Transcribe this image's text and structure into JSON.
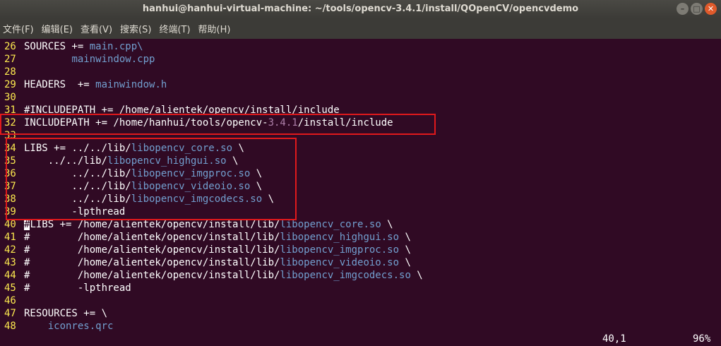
{
  "window": {
    "title": "hanhui@hanhui-virtual-machine: ~/tools/opencv-3.4.1/install/QOpenCV/opencvdemo",
    "buttons": [
      "minimize",
      "maximize",
      "close"
    ]
  },
  "menu": [
    "文件(F)",
    "编辑(E)",
    "查看(V)",
    "搜索(S)",
    "终端(T)",
    "帮助(H)"
  ],
  "lines": [
    {
      "n": "26",
      "segs": [
        [
          "SOURCES += ",
          ""
        ],
        [
          "main.cpp\\",
          "fnblue"
        ]
      ]
    },
    {
      "n": "27",
      "segs": [
        [
          "        ",
          ""
        ],
        [
          "mainwindow.cpp",
          "fnblue"
        ]
      ]
    },
    {
      "n": "28",
      "segs": []
    },
    {
      "n": "29",
      "segs": [
        [
          "HEADERS  += ",
          ""
        ],
        [
          "mainwindow.h",
          "fnblue"
        ]
      ]
    },
    {
      "n": "30",
      "segs": []
    },
    {
      "n": "31",
      "segs": [
        [
          "#INCLUDEPATH += /home/alientek/opencv/install/include",
          ""
        ]
      ]
    },
    {
      "n": "32",
      "segs": [
        [
          "INCLUDEPATH += /home/hanhui/tools/opencv-",
          ""
        ],
        [
          "3.4.1",
          "num"
        ],
        [
          "/install/include",
          ""
        ]
      ]
    },
    {
      "n": "33",
      "segs": []
    },
    {
      "n": "34",
      "segs": [
        [
          "LIBS += ../../lib/",
          ""
        ],
        [
          "libopencv_core.so",
          "fnblue"
        ],
        [
          " \\",
          ""
        ]
      ]
    },
    {
      "n": "35",
      "segs": [
        [
          "    ../../lib/",
          ""
        ],
        [
          "libopencv_highgui.so",
          "fnblue"
        ],
        [
          " \\",
          ""
        ]
      ]
    },
    {
      "n": "36",
      "segs": [
        [
          "        ../../lib/",
          ""
        ],
        [
          "libopencv_imgproc.so",
          "fnblue"
        ],
        [
          " \\",
          ""
        ]
      ]
    },
    {
      "n": "37",
      "segs": [
        [
          "        ../../lib/",
          ""
        ],
        [
          "libopencv_videoio.so",
          "fnblue"
        ],
        [
          " \\",
          ""
        ]
      ]
    },
    {
      "n": "38",
      "segs": [
        [
          "        ../../lib/",
          ""
        ],
        [
          "libopencv_imgcodecs.so",
          "fnblue"
        ],
        [
          " \\",
          ""
        ]
      ]
    },
    {
      "n": "39",
      "segs": [
        [
          "        -lpthread",
          ""
        ]
      ]
    },
    {
      "n": "40",
      "segs": [
        [
          "#",
          "cursor"
        ],
        [
          "LIBS += /home/alientek/opencv/install/lib/",
          ""
        ],
        [
          "libopencv_core.so",
          "fnblue"
        ],
        [
          " \\",
          ""
        ]
      ]
    },
    {
      "n": "41",
      "segs": [
        [
          "#        /home/alientek/opencv/install/lib/",
          ""
        ],
        [
          "libopencv_highgui.so",
          "fnblue"
        ],
        [
          " \\",
          ""
        ]
      ]
    },
    {
      "n": "42",
      "segs": [
        [
          "#        /home/alientek/opencv/install/lib/",
          ""
        ],
        [
          "libopencv_imgproc.so",
          "fnblue"
        ],
        [
          " \\",
          ""
        ]
      ]
    },
    {
      "n": "43",
      "segs": [
        [
          "#        /home/alientek/opencv/install/lib/",
          ""
        ],
        [
          "libopencv_videoio.so",
          "fnblue"
        ],
        [
          " \\",
          ""
        ]
      ]
    },
    {
      "n": "44",
      "segs": [
        [
          "#        /home/alientek/opencv/install/lib/",
          ""
        ],
        [
          "libopencv_imgcodecs.so",
          "fnblue"
        ],
        [
          " \\",
          ""
        ]
      ]
    },
    {
      "n": "45",
      "segs": [
        [
          "#        -lpthread",
          ""
        ]
      ]
    },
    {
      "n": "46",
      "segs": []
    },
    {
      "n": "47",
      "segs": [
        [
          "RESOURCES += \\",
          ""
        ]
      ]
    },
    {
      "n": "48",
      "segs": [
        [
          "    ",
          ""
        ],
        [
          "iconres.qrc",
          "fnblue"
        ]
      ]
    }
  ],
  "status": {
    "position": "40,1",
    "percent": "96%"
  },
  "colors": {
    "background": "#300a24",
    "highlight_box": "#e0191c",
    "line_numbers": "#fce94f",
    "filenames": "#729fcf"
  }
}
